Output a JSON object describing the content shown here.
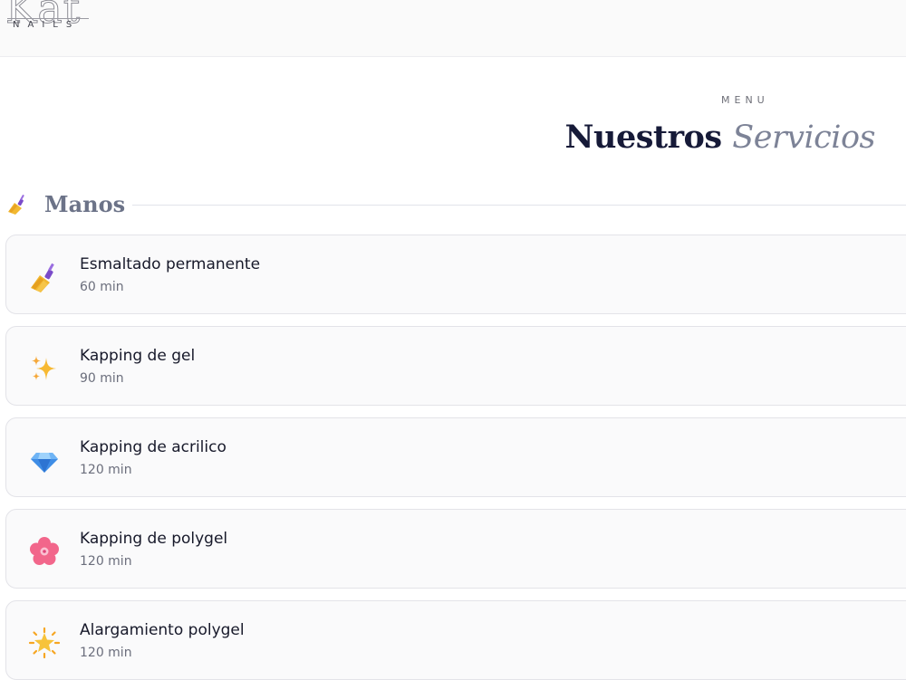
{
  "brand": {
    "logo_word": "Kat",
    "logo_sub": "NAILS"
  },
  "header": {
    "eyebrow": "MENU",
    "title_main": "Nuestros",
    "title_accent": "Servicios"
  },
  "section": {
    "icon": "nail-polish-icon",
    "title": "Manos"
  },
  "services": [
    {
      "icon": "nail-polish-icon",
      "name": "Esmaltado permanente",
      "duration": "60 min"
    },
    {
      "icon": "sparkles-icon",
      "name": "Kapping de gel",
      "duration": "90 min"
    },
    {
      "icon": "gem-icon",
      "name": "Kapping de acrilico",
      "duration": "120 min"
    },
    {
      "icon": "cherry-blossom-icon",
      "name": "Kapping de polygel",
      "duration": "120 min"
    },
    {
      "icon": "glowing-star-icon",
      "name": "Alargamiento polygel",
      "duration": "120 min"
    }
  ],
  "colors": {
    "title": "#161a38",
    "accent": "#7d8397",
    "card_bg": "#fafafb",
    "card_border": "#e3e3e8"
  }
}
